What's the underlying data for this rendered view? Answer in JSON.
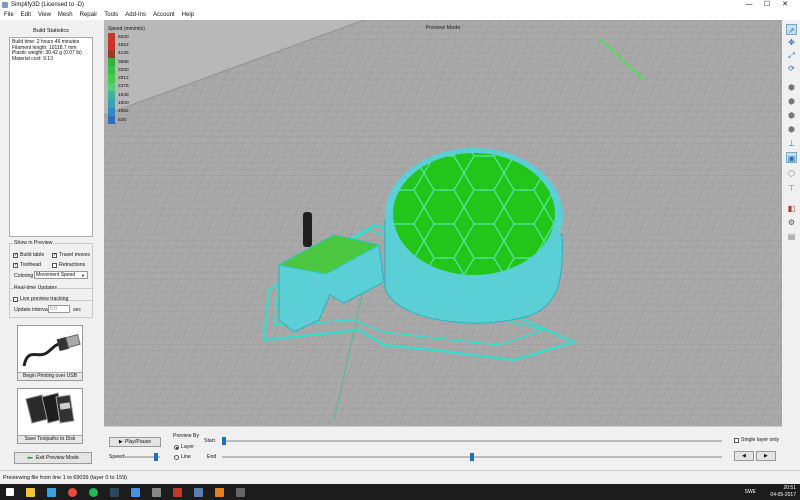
{
  "window": {
    "title": "Simplify3D (Licensed to -D)",
    "controls": [
      "—",
      "☐",
      "✕"
    ]
  },
  "menu": [
    "File",
    "Edit",
    "View",
    "Mesh",
    "Repair",
    "Tools",
    "Add-Ins",
    "Account",
    "Help"
  ],
  "build_stats": {
    "title": "Build Statistics",
    "lines": [
      "Build time: 2 hours 46 minutes",
      "Filament length: 10118.7 mm",
      "Plastic weight: 30.42 g (0.07 lb)",
      "Material cost: 9.13"
    ]
  },
  "show_in_preview": {
    "title": "Show in Preview",
    "build_table": "Build table",
    "travel_moves": "Travel moves",
    "toolhead": "Toolhead",
    "retractions": "Retractions",
    "coloring_label": "Coloring",
    "coloring_value": "Movement Speed"
  },
  "checks": {
    "build_table": true,
    "travel_moves": true,
    "toolhead": true,
    "retractions": false,
    "live_preview": false
  },
  "realtime": {
    "title": "Real-time Updates",
    "live_preview": "Live preview tracking",
    "interval_label": "Update interval",
    "interval_value": "5.0",
    "interval_unit": "sec"
  },
  "usb_button": "Begin Printing over USB",
  "sd_button": "Save Toolpaths to Disk",
  "exit_button": "Exit Preview Mode",
  "viewport": {
    "label": "Preview Mode"
  },
  "legend": {
    "title": "Speed (mm/min)",
    "entries": [
      {
        "value": "5000",
        "color": "#c0392b"
      },
      {
        "value": "4562",
        "color": "#d0302a"
      },
      {
        "value": "4125",
        "color": "#9a3a2a"
      },
      {
        "value": "3688",
        "color": "#2db53c"
      },
      {
        "value": "3250",
        "color": "#33c445"
      },
      {
        "value": "2812",
        "color": "#43cc4b"
      },
      {
        "value": "2375",
        "color": "#55cf77"
      },
      {
        "value": "1938",
        "color": "#3fb39a"
      },
      {
        "value": "1500",
        "color": "#3aa2b7"
      },
      {
        "value": "1062",
        "color": "#3887c2"
      },
      {
        "value": "625",
        "color": "#2f6fbf"
      }
    ]
  },
  "colors": {
    "travel": "#33e0d0",
    "infill": "#22c51a",
    "wall": "#5ad0d6",
    "bed": "#b8b8b8"
  },
  "controls": {
    "play_pause": "Play/Pause",
    "speed_label": "Speed:",
    "preview_by": "Preview By",
    "layer": "Layer",
    "line": "Line",
    "preview_mode_selected": "Layer",
    "start_label": "Start",
    "end_label": "End",
    "single_layer": "Single layer only",
    "prev": "◀",
    "next": "▶",
    "start_position": 0.0,
    "end_position": 0.5,
    "speed_level": 0.95
  },
  "status": "Previewing file from line 1 to 69039 (layer 0 to 159)",
  "tray": {
    "time": "20:51",
    "date": "04-05-2017",
    "lang": "SWE"
  }
}
